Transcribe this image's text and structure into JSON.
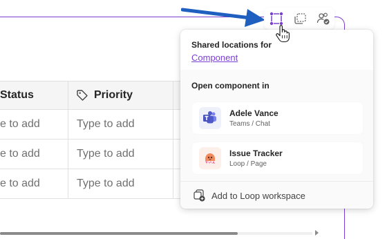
{
  "toolbar": {
    "buttons": [
      {
        "icon": "component-select-icon",
        "active": true
      },
      {
        "icon": "copy-component-icon",
        "active": false
      },
      {
        "icon": "people-check-icon",
        "active": false
      }
    ]
  },
  "table": {
    "columns": [
      {
        "label": "Status"
      },
      {
        "label": "Priority",
        "icon": "tag-icon"
      }
    ],
    "rows": [
      {
        "status": "e to add",
        "priority": "Type to add"
      },
      {
        "status": "e to add",
        "priority": "Type to add"
      },
      {
        "status": "e to add",
        "priority": "Type to add"
      }
    ]
  },
  "popup": {
    "title": "Shared locations for",
    "link": "Component",
    "section_label": "Open component in",
    "locations": [
      {
        "title": "Adele Vance",
        "subtitle": "Teams / Chat",
        "icon": "teams-icon"
      },
      {
        "title": "Issue Tracker",
        "subtitle": "Loop / Page",
        "icon": "loop-page-icon"
      }
    ],
    "footer_action": "Add to Loop workspace"
  },
  "colors": {
    "accent": "#7a3fd1",
    "arrow": "#1f5fbf"
  }
}
